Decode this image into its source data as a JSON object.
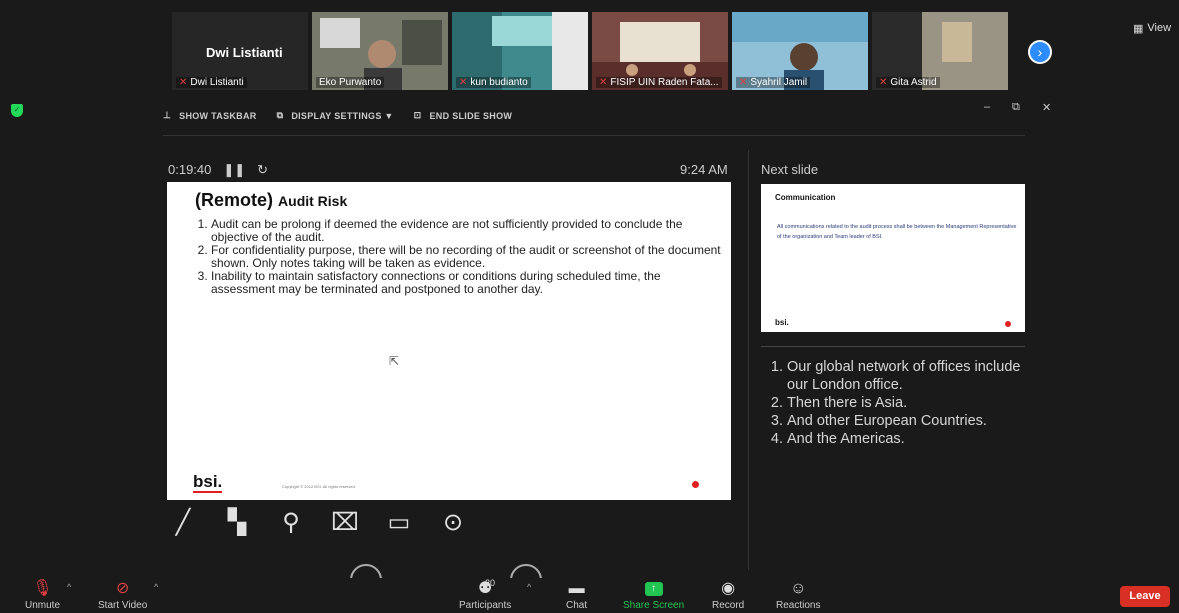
{
  "participants_strip": [
    {
      "big_name": "Dwi Listianti",
      "label": "Dwi Listianti",
      "bg": "#262626"
    },
    {
      "label": "Eko Purwanto",
      "bg": "#6b6f5a"
    },
    {
      "label": "kun budianto",
      "bg": "#4a8f8f"
    },
    {
      "label": "FISIP UIN Raden Fata...",
      "bg": "#6a3f3a"
    },
    {
      "label": "Syahril Jamil",
      "bg": "#5e9ec2"
    },
    {
      "label": "Gita Astrid",
      "bg": "#8a8a7a"
    }
  ],
  "view_label": "View",
  "presenter_toolbar": {
    "show_taskbar": "SHOW TASKBAR",
    "display_settings": "DISPLAY SETTINGS ▼",
    "end_slide_show": "END SLIDE SHOW"
  },
  "timer": "0:19:40",
  "clock": "9:24 AM",
  "current_slide": {
    "title_big": "(Remote)",
    "title_small": "Audit Risk",
    "points": [
      "Audit can be prolong if deemed the evidence are not sufficiently provided to conclude the objective of the audit.",
      "For confidentiality purpose, there will be no recording of the audit or screenshot of the document shown. Only notes taking will be taken as evidence.",
      "Inability to maintain satisfactory connections or conditions during scheduled time, the assessment may be terminated and postponed to another day."
    ],
    "logo": "bsi."
  },
  "next_slide": {
    "label": "Next slide",
    "title": "Communication",
    "body": "All communications related to the audit process shall be between the Management Representative of the organization and Team leader of BSI.",
    "logo": "bsi."
  },
  "notes": [
    "Our global network of offices include our London office.",
    "Then there is Asia.",
    "And other European Countries.",
    "And the Americas."
  ],
  "bottom_toolbar": {
    "unmute": "Unmute",
    "start_video": "Start Video",
    "participants": "Participants",
    "participants_count": "20",
    "chat": "Chat",
    "share_screen": "Share Screen",
    "record": "Record",
    "reactions": "Reactions",
    "leave": "Leave"
  },
  "colors": {
    "accent_blue": "#2d8cff",
    "share_green": "#23c552",
    "leave_red": "#d93025",
    "mute_red": "#e04040"
  }
}
